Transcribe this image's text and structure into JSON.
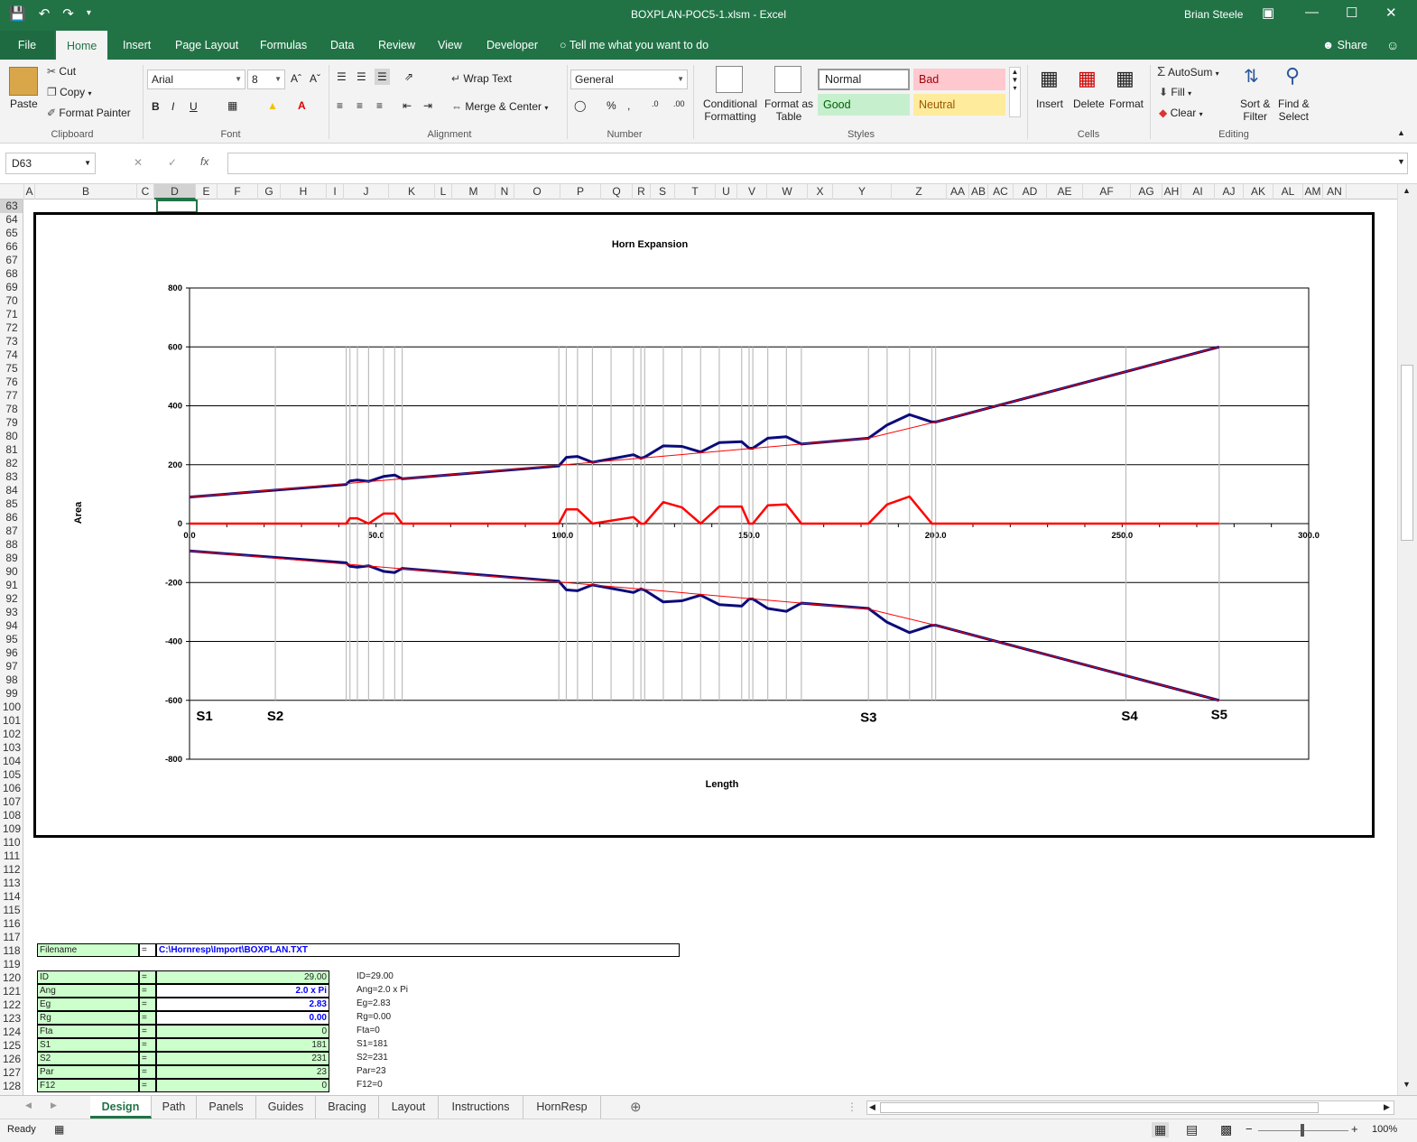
{
  "window": {
    "title": "BOXPLAN-POC5-1.xlsm  -  Excel",
    "user": "Brian Steele"
  },
  "ribbon_tabs": [
    "File",
    "Home",
    "Insert",
    "Page Layout",
    "Formulas",
    "Data",
    "Review",
    "View",
    "Developer"
  ],
  "tell_me": "Tell me what you want to do",
  "share": "Share",
  "clipboard": {
    "paste": "Paste",
    "cut": "Cut",
    "copy": "Copy",
    "format_painter": "Format Painter",
    "label": "Clipboard"
  },
  "font": {
    "name": "Arial",
    "size": "8",
    "label": "Font"
  },
  "alignment": {
    "wrap": "Wrap Text",
    "merge": "Merge & Center",
    "label": "Alignment"
  },
  "number": {
    "format": "General",
    "label": "Number"
  },
  "styles": {
    "conditional": "Conditional",
    "conditional2": "Formatting",
    "format_as": "Format as",
    "format_as2": "Table",
    "normal": "Normal",
    "bad": "Bad",
    "good": "Good",
    "neutral": "Neutral",
    "label": "Styles",
    "colors": {
      "bad_bg": "#ffc7ce",
      "bad_fg": "#9c0006",
      "good_bg": "#c6efce",
      "good_fg": "#006100",
      "neutral_bg": "#ffeb9c",
      "neutral_fg": "#9c5700"
    }
  },
  "cells_group": {
    "insert": "Insert",
    "delete": "Delete",
    "format": "Format",
    "label": "Cells"
  },
  "editing": {
    "autosum": "AutoSum",
    "fill": "Fill",
    "clear": "Clear",
    "sort": "Sort &",
    "sort2": "Filter",
    "find": "Find &",
    "find2": "Select",
    "label": "Editing"
  },
  "formula_bar": {
    "name_box": "D63",
    "fx": "fx",
    "value": ""
  },
  "columns": [
    "A",
    "B",
    "C",
    "D",
    "E",
    "F",
    "G",
    "H",
    "I",
    "J",
    "K",
    "L",
    "M",
    "N",
    "O",
    "P",
    "Q",
    "R",
    "S",
    "T",
    "U",
    "V",
    "W",
    "X",
    "Y",
    "Z",
    "AA",
    "AB",
    "AC",
    "AD",
    "AE",
    "AF",
    "AG",
    "AH",
    "AI",
    "AJ",
    "AK",
    "AL",
    "AM",
    "AN"
  ],
  "rows": [
    "63",
    "64",
    "65",
    "66",
    "67",
    "68",
    "69",
    "70",
    "71",
    "72",
    "73",
    "74",
    "75",
    "76",
    "77",
    "78",
    "79",
    "80",
    "81",
    "82",
    "83",
    "84",
    "85",
    "86",
    "87",
    "88",
    "89",
    "90",
    "91",
    "92",
    "93",
    "94",
    "95",
    "96",
    "97",
    "98",
    "99",
    "100",
    "101",
    "102",
    "103",
    "104",
    "105",
    "106",
    "107",
    "108",
    "109",
    "110",
    "111",
    "112",
    "113",
    "114",
    "115",
    "116",
    "117",
    "118",
    "119",
    "120",
    "121",
    "122",
    "123",
    "124",
    "125",
    "126",
    "127",
    "128"
  ],
  "chart_data": {
    "type": "line",
    "title": "Horn Expansion",
    "xlabel": "Length",
    "ylabel": "Area",
    "xlim": [
      0,
      300
    ],
    "ylim": [
      -800,
      800
    ],
    "x_ticks": [
      "0.0",
      "50.0",
      "100.0",
      "150.0",
      "200.0",
      "250.0",
      "300.0"
    ],
    "y_ticks": [
      "800",
      "600",
      "400",
      "200",
      "0",
      "-200",
      "-400",
      "-600",
      "-800"
    ],
    "grid": "horizontal",
    "vertical_markers_x": [
      23,
      42,
      43,
      45,
      48,
      52,
      55,
      57,
      99,
      101,
      104,
      108,
      113,
      119,
      121,
      122,
      127,
      132,
      137,
      142,
      148,
      150,
      151,
      155,
      160,
      164,
      182,
      187,
      193,
      199,
      200,
      251,
      276
    ],
    "section_labels": [
      {
        "text": "S1",
        "x": 4,
        "y": -650
      },
      {
        "text": "S2",
        "x": 23,
        "y": -650
      },
      {
        "text": "S3",
        "x": 182,
        "y": -655
      },
      {
        "text": "S4",
        "x": 252,
        "y": -650
      },
      {
        "text": "S5",
        "x": 276,
        "y": -645
      }
    ],
    "series": [
      {
        "color": "#0b0b7a",
        "points": [
          [
            0,
            90
          ],
          [
            42,
            133
          ],
          [
            43,
            145
          ],
          [
            45,
            148
          ],
          [
            48,
            143
          ],
          [
            52,
            160
          ],
          [
            55,
            165
          ],
          [
            57,
            152
          ],
          [
            99,
            196
          ],
          [
            101,
            225
          ],
          [
            104,
            228
          ],
          [
            108,
            208
          ],
          [
            119,
            234
          ],
          [
            121,
            222
          ],
          [
            122,
            226
          ],
          [
            127,
            264
          ],
          [
            132,
            262
          ],
          [
            137,
            243
          ],
          [
            142,
            275
          ],
          [
            148,
            278
          ],
          [
            150,
            256
          ],
          [
            151,
            256
          ],
          [
            155,
            290
          ],
          [
            160,
            295
          ],
          [
            164,
            270
          ],
          [
            182,
            290
          ],
          [
            187,
            335
          ],
          [
            193,
            370
          ],
          [
            199,
            345
          ],
          [
            200,
            345
          ],
          [
            276,
            600
          ]
        ]
      },
      {
        "color": "#0b0b7a",
        "points": [
          [
            0,
            -93
          ],
          [
            42,
            -133
          ],
          [
            43,
            -145
          ],
          [
            45,
            -148
          ],
          [
            48,
            -143
          ],
          [
            52,
            -162
          ],
          [
            55,
            -166
          ],
          [
            57,
            -152
          ],
          [
            99,
            -196
          ],
          [
            101,
            -225
          ],
          [
            104,
            -228
          ],
          [
            108,
            -208
          ],
          [
            119,
            -234
          ],
          [
            121,
            -222
          ],
          [
            122,
            -226
          ],
          [
            127,
            -266
          ],
          [
            132,
            -262
          ],
          [
            137,
            -243
          ],
          [
            142,
            -275
          ],
          [
            148,
            -280
          ],
          [
            150,
            -256
          ],
          [
            151,
            -256
          ],
          [
            155,
            -288
          ],
          [
            160,
            -298
          ],
          [
            164,
            -270
          ],
          [
            182,
            -288
          ],
          [
            187,
            -335
          ],
          [
            193,
            -370
          ],
          [
            199,
            -345
          ],
          [
            200,
            -345
          ],
          [
            276,
            -600
          ]
        ]
      },
      {
        "color": "#ff0000",
        "width": 1,
        "points": [
          [
            0,
            90
          ],
          [
            99,
            198
          ],
          [
            182,
            290
          ],
          [
            200,
            345
          ],
          [
            276,
            600
          ]
        ]
      },
      {
        "color": "#ff0000",
        "width": 1,
        "points": [
          [
            0,
            -93
          ],
          [
            99,
            -198
          ],
          [
            182,
            -290
          ],
          [
            200,
            -345
          ],
          [
            276,
            -600
          ]
        ]
      },
      {
        "color": "#ff0000",
        "width": 2.5,
        "points": [
          [
            0,
            0
          ],
          [
            42,
            0
          ],
          [
            43,
            18
          ],
          [
            45,
            18
          ],
          [
            48,
            0
          ],
          [
            52,
            34
          ],
          [
            55,
            34
          ],
          [
            57,
            0
          ],
          [
            99,
            0
          ],
          [
            101,
            48
          ],
          [
            104,
            48
          ],
          [
            108,
            0
          ],
          [
            119,
            22
          ],
          [
            121,
            0
          ],
          [
            122,
            0
          ],
          [
            127,
            73
          ],
          [
            132,
            55
          ],
          [
            137,
            0
          ],
          [
            142,
            58
          ],
          [
            148,
            58
          ],
          [
            150,
            0
          ],
          [
            151,
            0
          ],
          [
            155,
            62
          ],
          [
            160,
            65
          ],
          [
            164,
            0
          ],
          [
            182,
            0
          ],
          [
            187,
            65
          ],
          [
            193,
            92
          ],
          [
            199,
            0
          ],
          [
            200,
            0
          ],
          [
            276,
            0
          ]
        ]
      }
    ]
  },
  "params": {
    "filename_label": "Filename",
    "filename_eq": "=",
    "filename_value": "C:\\Hornresp\\Import\\BOXPLAN.TXT",
    "rows": [
      {
        "label": "ID",
        "eq": "=",
        "value": "29.00",
        "summary": "ID=29.00",
        "blue": false
      },
      {
        "label": "Ang",
        "eq": "=",
        "value": "2.0 x Pi",
        "summary": "Ang=2.0 x Pi",
        "blue": true
      },
      {
        "label": "Eg",
        "eq": "=",
        "value": "2.83",
        "summary": "Eg=2.83",
        "blue": true
      },
      {
        "label": "Rg",
        "eq": "=",
        "value": "0.00",
        "summary": "Rg=0.00",
        "blue": true
      },
      {
        "label": "Fta",
        "eq": "=",
        "value": "0",
        "summary": "Fta=0",
        "blue": false
      },
      {
        "label": "S1",
        "eq": "=",
        "value": "181",
        "summary": "S1=181",
        "blue": false
      },
      {
        "label": "S2",
        "eq": "=",
        "value": "231",
        "summary": "S2=231",
        "blue": false
      },
      {
        "label": "Par",
        "eq": "=",
        "value": "23",
        "summary": "Par=23",
        "blue": false
      },
      {
        "label": "F12",
        "eq": "=",
        "value": "0",
        "summary": "F12=0",
        "blue": false
      }
    ]
  },
  "sheet_tabs": [
    "Design",
    "Path",
    "Panels",
    "Guides",
    "Bracing",
    "Layout",
    "Instructions",
    "HornResp"
  ],
  "status": {
    "ready": "Ready",
    "zoom": "100%"
  }
}
